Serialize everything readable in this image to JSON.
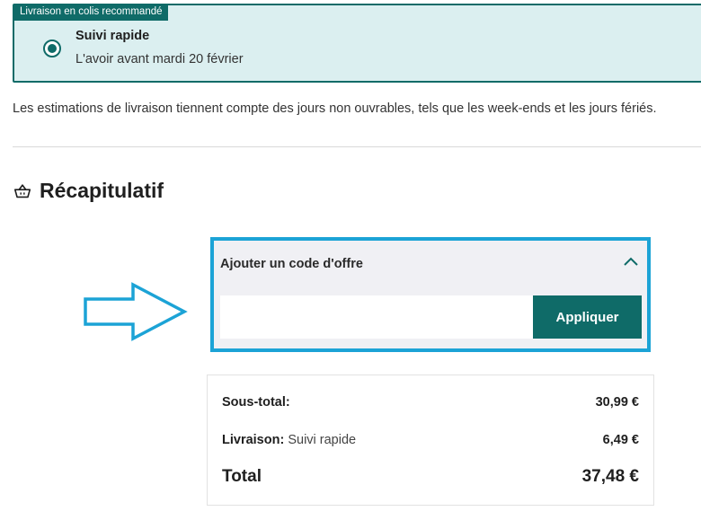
{
  "shipping": {
    "badge": "Livraison en colis recommandé",
    "option_name": "Suivi rapide",
    "option_date": "L'avoir avant mardi 20 février",
    "selected": true,
    "notice": "Les estimations de livraison tiennent compte des jours non ouvrables, tels que les week-ends et les jours fériés."
  },
  "summary": {
    "title": "Récapitulatif",
    "icon": "basket-icon"
  },
  "promo": {
    "title": "Ajouter un code d'offre",
    "input_value": "",
    "input_placeholder": "",
    "apply_label": "Appliquer",
    "highlight_color": "#1ca3d6"
  },
  "totals": {
    "subtotal_label": "Sous-total:",
    "subtotal_value": "30,99 €",
    "shipping_label": "Livraison:",
    "shipping_method": "Suivi rapide",
    "shipping_value": "6,49 €",
    "total_label": "Total",
    "total_value": "37,48 €"
  },
  "colors": {
    "brand": "#0f6b68",
    "card_bg": "#dbeff0"
  }
}
